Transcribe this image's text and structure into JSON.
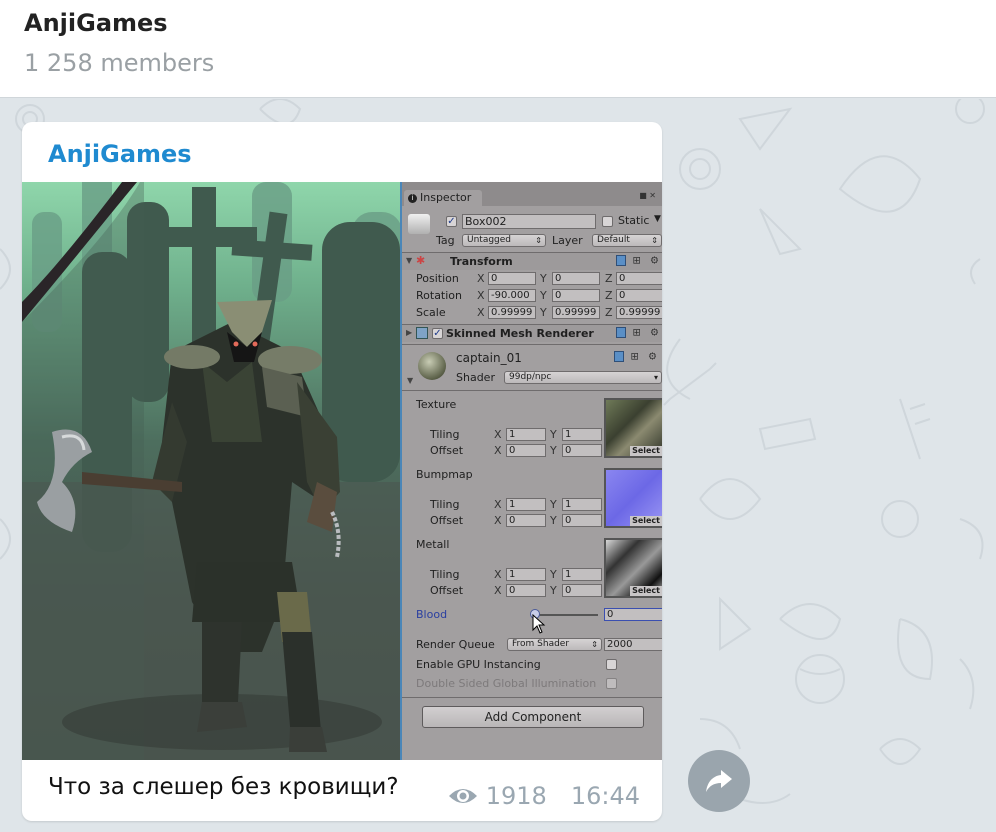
{
  "header": {
    "title": "AnjiGames",
    "subtitle": "1 258 members"
  },
  "message": {
    "author": "AnjiGames",
    "caption": "Что за слешер без кровищи?",
    "views": "1918",
    "time": "16:44",
    "author_color": "#1f8ad0"
  },
  "inspector": {
    "tab_label": "Inspector",
    "object_name": "Box002",
    "object_active": true,
    "static_label": "Static",
    "static_checked": false,
    "tag_label": "Tag",
    "tag_value": "Untagged",
    "layer_label": "Layer",
    "layer_value": "Default",
    "transform": {
      "title": "Transform",
      "rows": [
        {
          "label": "Position",
          "x": "0",
          "y": "0",
          "z": "0"
        },
        {
          "label": "Rotation",
          "x": "-90.000",
          "y": "0",
          "z": "0"
        },
        {
          "label": "Scale",
          "x": "0.99999",
          "y": "0.99999",
          "z": "0.99999"
        }
      ]
    },
    "skinned_mesh": {
      "title": "Skinned Mesh Renderer",
      "enabled": true
    },
    "material": {
      "name": "captain_01",
      "shader_label": "Shader",
      "shader_value": "99dp/npc",
      "textures": [
        {
          "label": "Texture",
          "tiling_x": "1",
          "tiling_y": "1",
          "offset_x": "0",
          "offset_y": "0"
        },
        {
          "label": "Bumpmap",
          "tiling_x": "1",
          "tiling_y": "1",
          "offset_x": "0",
          "offset_y": "0"
        },
        {
          "label": "Metall",
          "tiling_x": "1",
          "tiling_y": "1",
          "offset_x": "0",
          "offset_y": "0"
        }
      ],
      "tiling_label": "Tiling",
      "offset_label": "Offset",
      "select_label": "Select",
      "x_label": "X",
      "y_label": "Y",
      "z_label": "Z",
      "blood_label": "Blood",
      "blood_value": "0",
      "blood_fraction": 0,
      "render_queue_label": "Render Queue",
      "render_queue_mode": "From Shader",
      "render_queue_value": "2000",
      "gpu_instancing_label": "Enable GPU Instancing",
      "gpu_instancing_checked": false,
      "double_sided_label": "Double Sided Global Illumination",
      "double_sided_checked": false
    },
    "add_component_label": "Add Component"
  },
  "icons": {
    "views": "eye-icon",
    "forward": "share-arrow-icon"
  }
}
